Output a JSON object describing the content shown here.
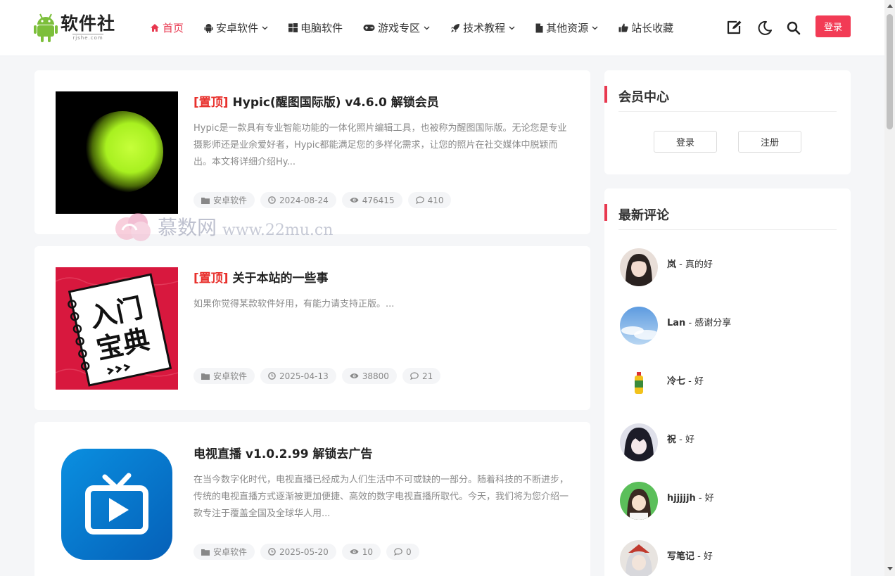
{
  "logo": {
    "name": "软件社",
    "domain": "rjshe.com",
    "brand_color": "#7cbf3b"
  },
  "nav": {
    "items": [
      {
        "label": "首页",
        "icon": "home-icon",
        "active": true,
        "dropdown": false
      },
      {
        "label": "安卓软件",
        "icon": "android-icon",
        "active": false,
        "dropdown": true
      },
      {
        "label": "电脑软件",
        "icon": "windows-icon",
        "active": false,
        "dropdown": false
      },
      {
        "label": "游戏专区",
        "icon": "gamepad-icon",
        "active": false,
        "dropdown": true
      },
      {
        "label": "技术教程",
        "icon": "rocket-icon",
        "active": false,
        "dropdown": true
      },
      {
        "label": "其他资源",
        "icon": "file-icon",
        "active": false,
        "dropdown": true
      },
      {
        "label": "站长收藏",
        "icon": "thumbs-up-icon",
        "active": false,
        "dropdown": false
      }
    ],
    "accent": "#e8384f"
  },
  "header_actions": {
    "login_label": "登录",
    "login_color": "#f23b55",
    "icons": [
      "edit-icon",
      "dark-mode-icon",
      "search-icon"
    ]
  },
  "posts": [
    {
      "tag": "[置顶]",
      "title": "Hypic(醒图国际版) v4.6.0 解锁会员",
      "excerpt": "Hypic是一款具有专业智能功能的一体化照片编辑工具，也被称为醒图国际版。无论您是专业摄影师还是业余爱好者，Hypic都能满足您的多样化需求，让您的照片在社交媒体中脱颖而出。本文将详细介绍Hy...",
      "category": "安卓软件",
      "date": "2024-08-24",
      "views": "476415",
      "comments": "410",
      "thumb": "hypic-logo"
    },
    {
      "tag": "[置顶]",
      "title": "关于本站的一些事",
      "excerpt": "如果你觉得某款软件好用，有能力请支持正版。...",
      "category": "安卓软件",
      "date": "2025-04-13",
      "views": "38800",
      "comments": "21",
      "thumb": "beginner-guide-book",
      "thumb_text": [
        "入门",
        "宝典"
      ]
    },
    {
      "tag": "",
      "title": "电视直播 v1.0.2.99 解锁去广告",
      "excerpt": "在当今数字化时代，电视直播已经成为人们生活中不可或缺的一部分。随着科技的不断进步，传统的电视直播方式逐渐被更加便捷、高效的数字电视直播所取代。今天，我们将为您介绍一款专注于覆盖全国及全球华人用...",
      "category": "安卓软件",
      "date": "2025-05-20",
      "views": "10",
      "comments": "0",
      "thumb": "tv-app-icon"
    }
  ],
  "member_center": {
    "title": "会员中心",
    "login_label": "登录",
    "register_label": "注册"
  },
  "latest_comments": {
    "title": "最新评论",
    "items": [
      {
        "user": "岚",
        "text": "真的好"
      },
      {
        "user": "Lan",
        "text": "感谢分享"
      },
      {
        "user": "冷七",
        "text": "好"
      },
      {
        "user": "祝",
        "text": "好"
      },
      {
        "user": "hjjjjjh",
        "text": "好"
      },
      {
        "user": "写笔记",
        "text": "好"
      }
    ]
  },
  "watermark": {
    "cn": "慕数网",
    "en": "www.22mu.cn"
  }
}
